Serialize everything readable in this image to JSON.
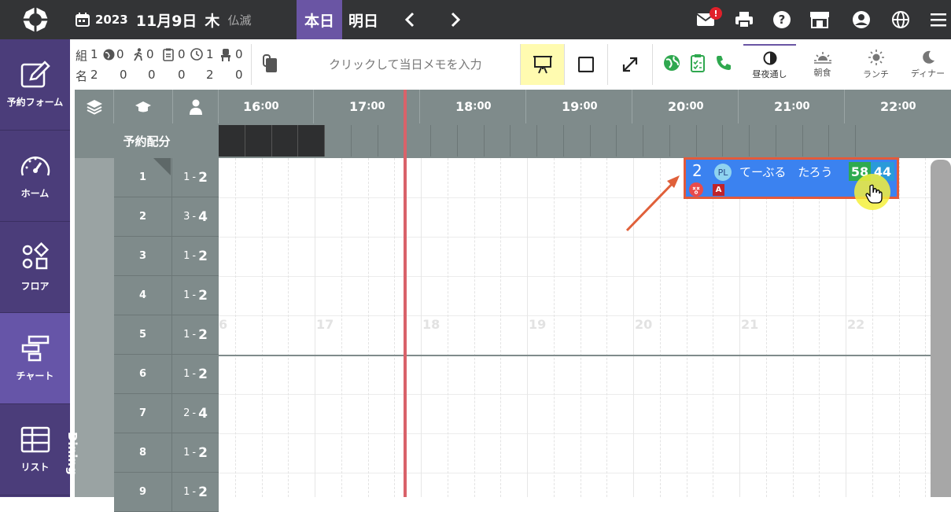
{
  "header": {
    "year": "2023",
    "monthday": "11月9日",
    "weekday": "木",
    "rokuyo": "仏滅",
    "today_label": "本日",
    "tomorrow_label": "明日",
    "notif_count": "!"
  },
  "sidebar": {
    "items": [
      {
        "label": "予約フォーム",
        "icon": "edit-icon"
      },
      {
        "label": "ホーム",
        "icon": "gauge-icon"
      },
      {
        "label": "フロア",
        "icon": "floor-shapes-icon"
      },
      {
        "label": "チャート",
        "icon": "chart-bars-icon"
      },
      {
        "label": "リスト",
        "icon": "table-icon"
      }
    ]
  },
  "stats": {
    "row1": {
      "label": "組",
      "total": "1",
      "web": "0",
      "walkin": "0",
      "unconfirmed": "0",
      "waiting": "1",
      "seated": "0"
    },
    "row2": {
      "label": "名",
      "total": "2",
      "web": "0",
      "walkin": "0",
      "unconfirmed": "0",
      "waiting": "2",
      "seated": "0"
    }
  },
  "memo": {
    "placeholder": "クリックして当日メモを入力"
  },
  "modes": [
    {
      "label": "昼夜通し",
      "active": true
    },
    {
      "label": "朝食",
      "active": false
    },
    {
      "label": "ランチ",
      "active": false
    },
    {
      "label": "ディナー",
      "active": false
    }
  ],
  "timeline": {
    "hours": [
      {
        "h": "16",
        "m": ":00"
      },
      {
        "h": "17",
        "m": ":00"
      },
      {
        "h": "18",
        "m": ":00"
      },
      {
        "h": "19",
        "m": ":00"
      },
      {
        "h": "20",
        "m": ":00"
      },
      {
        "h": "21",
        "m": ":00"
      },
      {
        "h": "22",
        "m": ":00"
      }
    ],
    "ghost_hours": [
      "6",
      "17",
      "18",
      "19",
      "20",
      "21",
      "22"
    ]
  },
  "allocation_label": "予約配分",
  "area_label": "Dining",
  "tables": [
    {
      "num": "1",
      "min": "1",
      "max": "2"
    },
    {
      "num": "2",
      "min": "3",
      "max": "4"
    },
    {
      "num": "3",
      "min": "1",
      "max": "2"
    },
    {
      "num": "4",
      "min": "1",
      "max": "2"
    },
    {
      "num": "5",
      "min": "1",
      "max": "2"
    },
    {
      "num": "6",
      "min": "1",
      "max": "2"
    },
    {
      "num": "7",
      "min": "2",
      "max": "4"
    },
    {
      "num": "8",
      "min": "1",
      "max": "2"
    },
    {
      "num": "9",
      "min": "1",
      "max": "2"
    }
  ],
  "reservation": {
    "people": "2",
    "badge": "PL",
    "name": "てーぶる　たろう",
    "tag1": "58",
    "tag2": "44",
    "flag": "A",
    "color_bg": "#3b82f0",
    "color_border": "#e45a3a"
  }
}
